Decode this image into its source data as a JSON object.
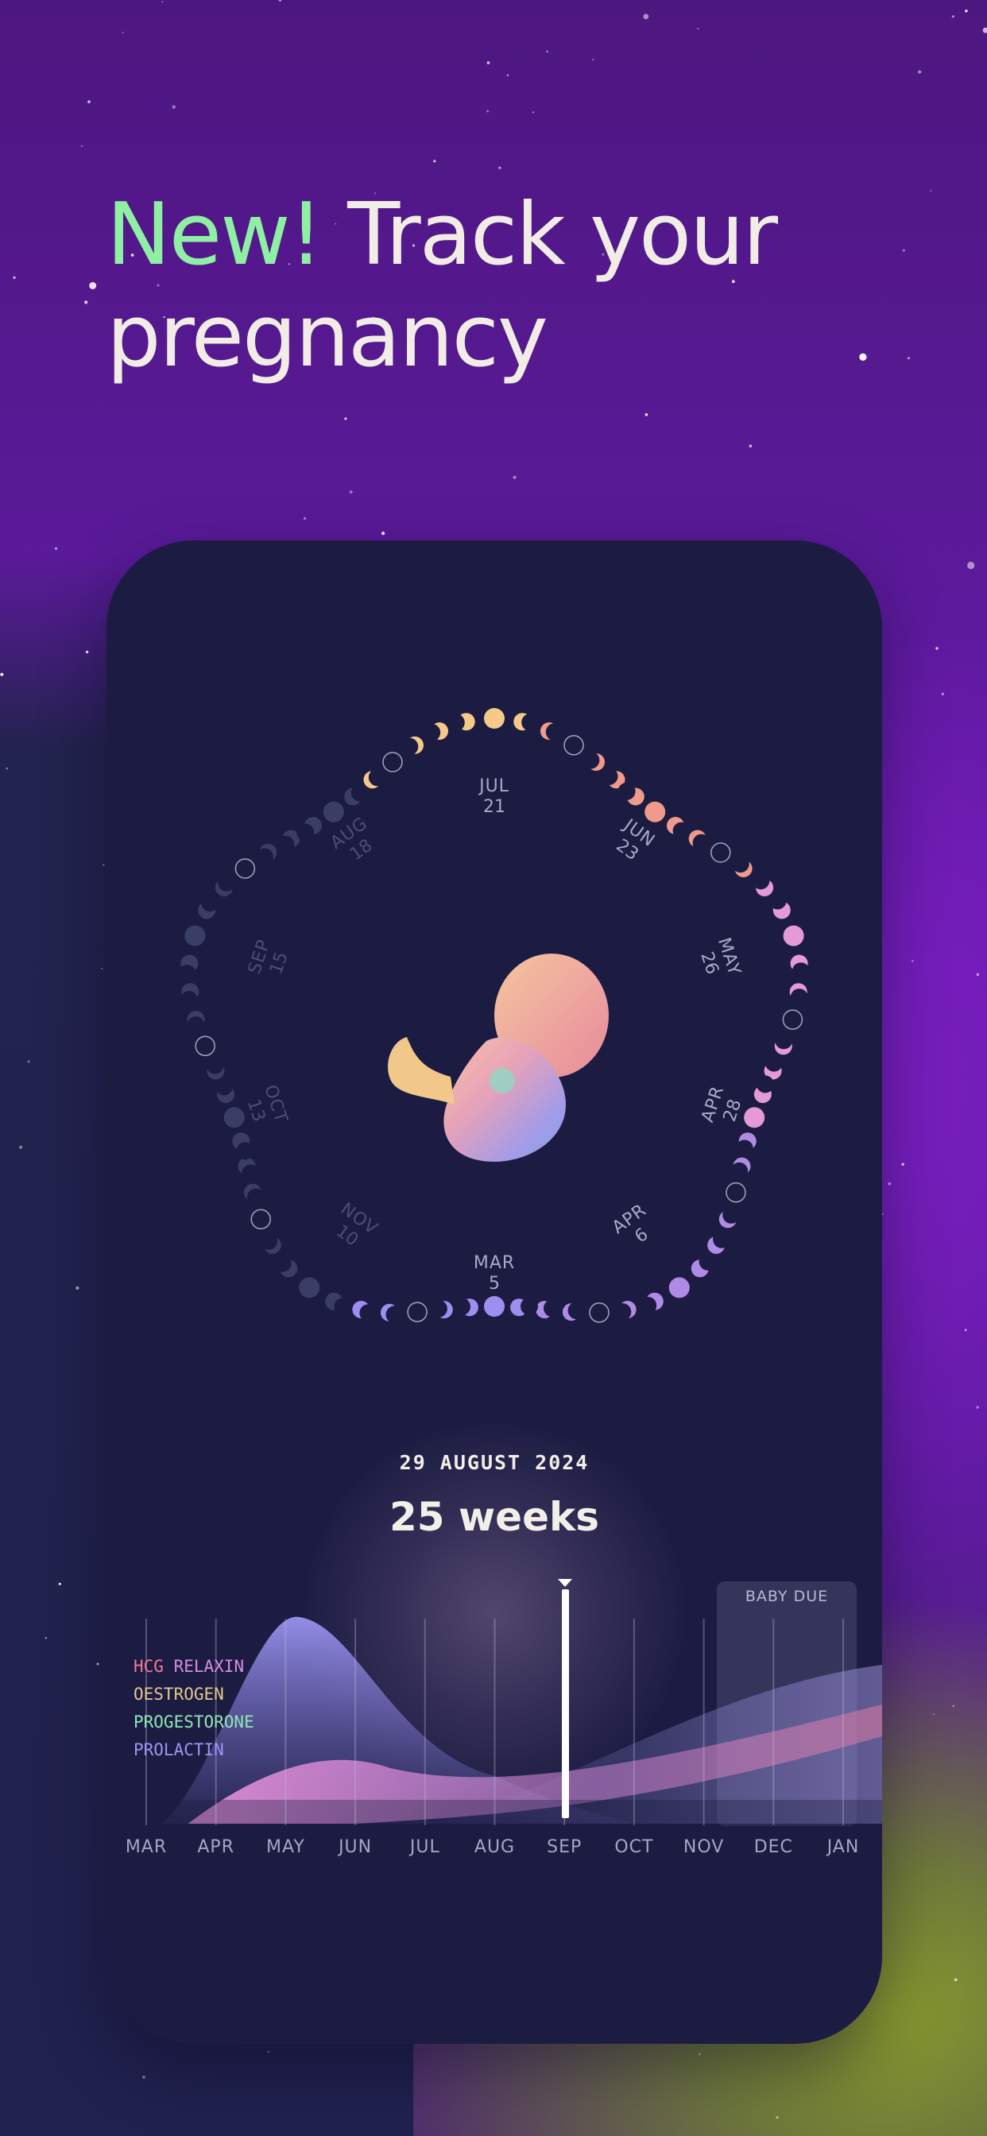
{
  "headline": {
    "accent": "New!",
    "rest": "Track your pregnancy"
  },
  "ring_labels": [
    {
      "month": "JUL",
      "day": "21"
    },
    {
      "month": "JUN",
      "day": "23"
    },
    {
      "month": "MAY",
      "day": "26"
    },
    {
      "month": "APR",
      "day": "28"
    },
    {
      "month": "APR",
      "day": "6"
    },
    {
      "month": "MAR",
      "day": "5"
    },
    {
      "month": "NOV",
      "day": "10"
    },
    {
      "month": "OCT",
      "day": "13"
    },
    {
      "month": "SEP",
      "day": "15"
    },
    {
      "month": "AUG",
      "day": "18"
    }
  ],
  "current": {
    "date": "29 AUGUST 2024",
    "weeks": "25 weeks"
  },
  "legend": [
    {
      "label": "HCG",
      "color": "#f07c9a"
    },
    {
      "label": "RELAXIN",
      "color": "#d78be0"
    },
    {
      "label": "OESTROGEN",
      "color": "#e3c78a"
    },
    {
      "label": "PROGESTORONE",
      "color": "#8fe6b4"
    },
    {
      "label": "PROLACTIN",
      "color": "#9c96f0"
    }
  ],
  "months": [
    "MAR",
    "APR",
    "MAY",
    "JUN",
    "JUL",
    "AUG",
    "SEP",
    "OCT",
    "NOV",
    "DEC",
    "JAN"
  ],
  "baby_due_label": "BABY DUE",
  "colors": {
    "accent_green": "#8ff0a4",
    "card_bg": "#1c1c42",
    "moon_yellow": "#f5c98a",
    "moon_salmon": "#f09a8a",
    "moon_pink": "#e59ad8",
    "moon_purple": "#b08be6",
    "moon_dim": "#3a3d66"
  }
}
